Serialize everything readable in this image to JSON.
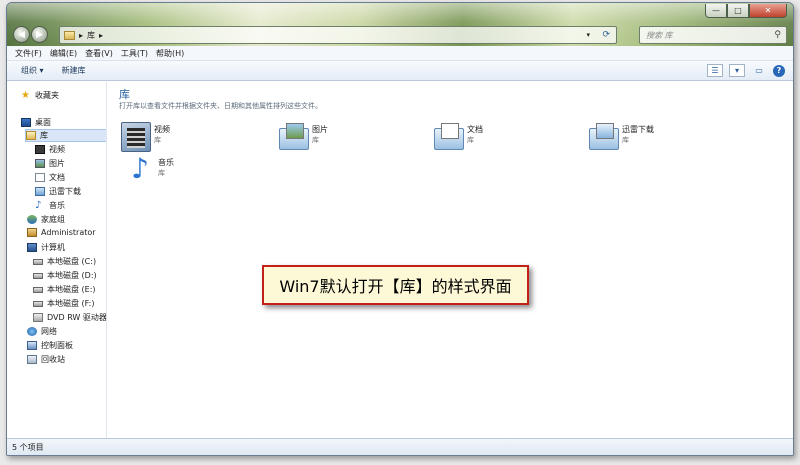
{
  "address": {
    "crumbs": [
      "▸",
      "库",
      "▸"
    ],
    "refresh_icon": "refresh-icon"
  },
  "search": {
    "placeholder": "搜索 库"
  },
  "caption": {
    "minimize": "—",
    "maximize": "□",
    "close": "✕"
  },
  "menu": [
    "文件(F)",
    "编辑(E)",
    "查看(V)",
    "工具(T)",
    "帮助(H)"
  ],
  "commands": {
    "organize": "组织 ▾",
    "new_library": "新建库"
  },
  "nav": {
    "favorites": "收藏夹",
    "desktop": "桌面",
    "libraries": "库",
    "videos": "视频",
    "pictures": "图片",
    "documents": "文档",
    "thunder": "迅雷下载",
    "music": "音乐",
    "homegroup": "家庭组",
    "admin": "Administrator",
    "computer": "计算机",
    "disk_c": "本地磁盘 (C:)",
    "disk_d": "本地磁盘 (D:)",
    "disk_e": "本地磁盘 (E:)",
    "disk_f": "本地磁盘 (F:)",
    "dvd": "DVD RW 驱动器 (",
    "network": "网络",
    "control_panel": "控制面板",
    "recycle_bin": "回收站"
  },
  "main": {
    "title": "库",
    "subtitle": "打开库以查看文件并根据文件夹、日期和其他属性排列这些文件。",
    "libraries": [
      {
        "name": "视频",
        "type": "库",
        "icon": "video-library-icon"
      },
      {
        "name": "图片",
        "type": "库",
        "icon": "pictures-library-icon"
      },
      {
        "name": "文档",
        "type": "库",
        "icon": "documents-library-icon"
      },
      {
        "name": "迅雷下载",
        "type": "库",
        "icon": "thunder-library-icon"
      },
      {
        "name": "音乐",
        "type": "库",
        "icon": "music-library-icon"
      }
    ]
  },
  "status": {
    "count": "5 个项目"
  },
  "annotation": {
    "text": "Win7默认打开【库】的样式界面"
  }
}
